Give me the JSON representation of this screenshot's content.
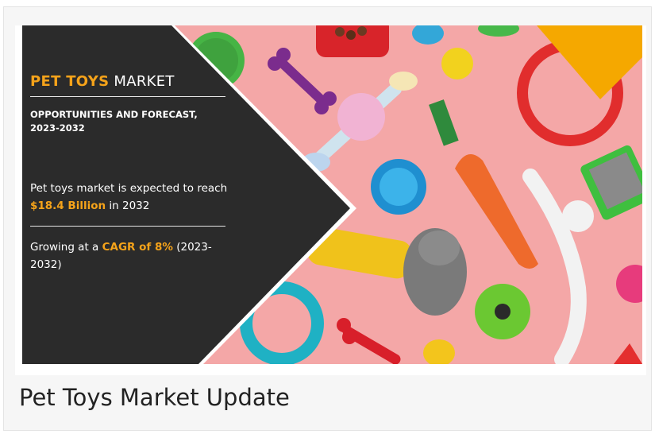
{
  "banner": {
    "title_highlight": "PET TOYS",
    "title_rest": " MARKET",
    "subtitle": "OPPORTUNITIES AND FORECAST, 2023-2032",
    "reach_prefix": "Pet toys market is expected to reach",
    "reach_value": "$18.4 Billion",
    "reach_suffix": " in 2032",
    "growth_prefix": "Growing at a ",
    "growth_value": "CAGR of 8%",
    "growth_suffix": " (2023-2032)"
  },
  "caption": "Pet Toys Market Update",
  "colors": {
    "panel": "#2b2b2b",
    "accent": "#f5a31a",
    "background_pink": "#f4a7a7"
  }
}
